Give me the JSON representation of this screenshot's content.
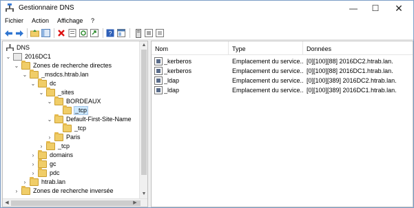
{
  "window": {
    "title": "Gestionnaire DNS",
    "minimize_glyph": "—",
    "maximize_glyph": "☐",
    "close_glyph": "✕"
  },
  "menu": {
    "items": [
      "Fichier",
      "Action",
      "Affichage",
      "?"
    ]
  },
  "toolbar": {
    "icons": [
      "back-icon",
      "forward-icon",
      "up-folder-icon",
      "console-tree-icon",
      "delete-icon",
      "properties-icon",
      "refresh-icon",
      "export-icon",
      "help-icon",
      "mmc-icon",
      "server-icon",
      "record-icon",
      "record-new-icon"
    ]
  },
  "tree": {
    "items": [
      {
        "label": "DNS",
        "expand": "",
        "icon": "dns"
      },
      {
        "label": "2016DC1",
        "expand": "⌄",
        "icon": "server"
      },
      {
        "label": "Zones de recherche directes",
        "expand": "⌄",
        "icon": "folder"
      },
      {
        "label": "_msdcs.htrab.lan",
        "expand": "⌄",
        "icon": "folder"
      },
      {
        "label": "dc",
        "expand": "⌄",
        "icon": "folder"
      },
      {
        "label": "_sites",
        "expand": "⌄",
        "icon": "folder"
      },
      {
        "label": "BORDEAUX",
        "expand": "⌄",
        "icon": "folder"
      },
      {
        "label": "_tcp",
        "expand": "",
        "icon": "folder",
        "selected": true
      },
      {
        "label": "Default-First-Site-Name",
        "expand": "⌄",
        "icon": "folder"
      },
      {
        "label": "_tcp",
        "expand": "",
        "icon": "folder"
      },
      {
        "label": "Paris",
        "expand": "›",
        "icon": "folder"
      },
      {
        "label": "_tcp",
        "expand": "›",
        "icon": "folder"
      },
      {
        "label": "domains",
        "expand": "›",
        "icon": "folder"
      },
      {
        "label": "gc",
        "expand": "›",
        "icon": "folder"
      },
      {
        "label": "pdc",
        "expand": "›",
        "icon": "folder"
      },
      {
        "label": "htrab.lan",
        "expand": "›",
        "icon": "folder"
      },
      {
        "label": "Zones de recherche inversée",
        "expand": "›",
        "icon": "folder"
      }
    ]
  },
  "list": {
    "columns": [
      "Nom",
      "Type",
      "Données"
    ],
    "rows": [
      {
        "name": "_kerberos",
        "type": "Emplacement du service...",
        "data": "[0][100][88] 2016DC2.htrab.lan."
      },
      {
        "name": "_kerberos",
        "type": "Emplacement du service...",
        "data": "[0][100][88] 2016DC1.htrab.lan."
      },
      {
        "name": "_ldap",
        "type": "Emplacement du service...",
        "data": "[0][100][389] 2016DC2.htrab.lan."
      },
      {
        "name": "_ldap",
        "type": "Emplacement du service...",
        "data": "[0][100][389] 2016DC1.htrab.lan."
      }
    ]
  },
  "colors": {
    "selection": "#cce8ff",
    "folder": "#f0cd68",
    "border": "#7a9cc6"
  }
}
